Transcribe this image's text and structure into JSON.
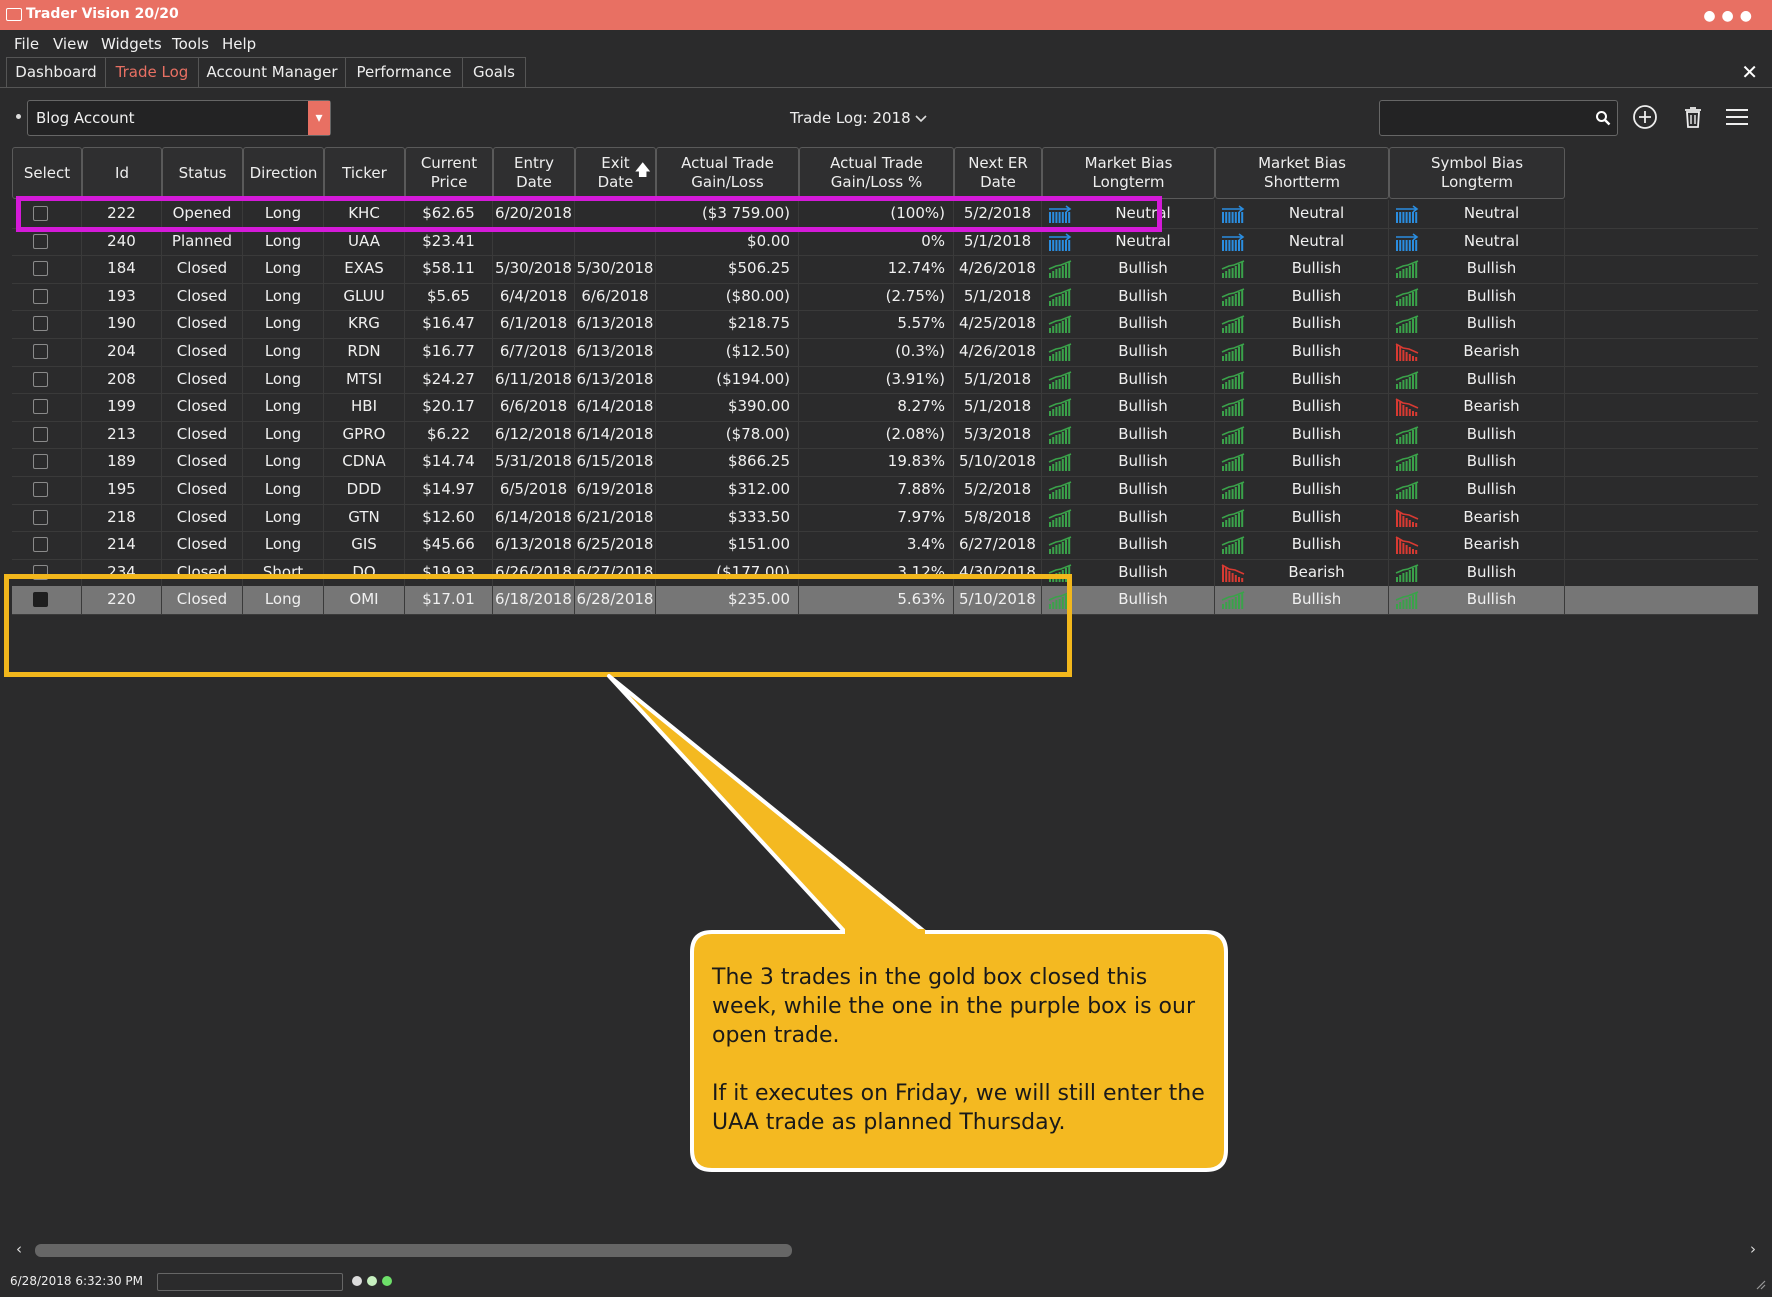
{
  "window": {
    "title": "Trader Vision 20/20"
  },
  "menu": [
    "File",
    "View",
    "Widgets",
    "Tools",
    "Help"
  ],
  "tabs": [
    {
      "label": "Dashboard",
      "active": false
    },
    {
      "label": "Trade Log",
      "active": true
    },
    {
      "label": "Account Manager",
      "active": false
    },
    {
      "label": "Performance",
      "active": false
    },
    {
      "label": "Goals",
      "active": false
    }
  ],
  "toolbar": {
    "account": "Blog Account",
    "trade_log_label": "Trade Log:",
    "year": "2018",
    "search_value": ""
  },
  "table": {
    "columns": [
      "Select",
      "Id",
      "Status",
      "Direction",
      "Ticker",
      "Current Price",
      "Entry Date",
      "Exit Date",
      "Actual Trade Gain/Loss",
      "Actual Trade Gain/Loss %",
      "Next ER Date",
      "Market Bias Longterm",
      "Market Bias Shortterm",
      "Symbol Bias Longterm"
    ],
    "sorted_column": "Exit Date",
    "rows": [
      {
        "checked": false,
        "id": "222",
        "status": "Opened",
        "direction": "Long",
        "ticker": "KHC",
        "price": "$62.65",
        "entry": "6/20/2018",
        "exit": "",
        "gain": "($3 759.00)",
        "gain_pct": "(100%)",
        "next_er": "5/2/2018",
        "mb_long": "Neutral",
        "mb_short": "Neutral",
        "sb_long": "Neutral"
      },
      {
        "checked": false,
        "id": "240",
        "status": "Planned",
        "direction": "Long",
        "ticker": "UAA",
        "price": "$23.41",
        "entry": "",
        "exit": "",
        "gain": "$0.00",
        "gain_pct": "0%",
        "next_er": "5/1/2018",
        "mb_long": "Neutral",
        "mb_short": "Neutral",
        "sb_long": "Neutral"
      },
      {
        "checked": false,
        "id": "184",
        "status": "Closed",
        "direction": "Long",
        "ticker": "EXAS",
        "price": "$58.11",
        "entry": "5/30/2018",
        "exit": "5/30/2018",
        "gain": "$506.25",
        "gain_pct": "12.74%",
        "next_er": "4/26/2018",
        "mb_long": "Bullish",
        "mb_short": "Bullish",
        "sb_long": "Bullish"
      },
      {
        "checked": false,
        "id": "193",
        "status": "Closed",
        "direction": "Long",
        "ticker": "GLUU",
        "price": "$5.65",
        "entry": "6/4/2018",
        "exit": "6/6/2018",
        "gain": "($80.00)",
        "gain_pct": "(2.75%)",
        "next_er": "5/1/2018",
        "mb_long": "Bullish",
        "mb_short": "Bullish",
        "sb_long": "Bullish"
      },
      {
        "checked": false,
        "id": "190",
        "status": "Closed",
        "direction": "Long",
        "ticker": "KRG",
        "price": "$16.47",
        "entry": "6/1/2018",
        "exit": "6/13/2018",
        "gain": "$218.75",
        "gain_pct": "5.57%",
        "next_er": "4/25/2018",
        "mb_long": "Bullish",
        "mb_short": "Bullish",
        "sb_long": "Bullish"
      },
      {
        "checked": false,
        "id": "204",
        "status": "Closed",
        "direction": "Long",
        "ticker": "RDN",
        "price": "$16.77",
        "entry": "6/7/2018",
        "exit": "6/13/2018",
        "gain": "($12.50)",
        "gain_pct": "(0.3%)",
        "next_er": "4/26/2018",
        "mb_long": "Bullish",
        "mb_short": "Bullish",
        "sb_long": "Bearish"
      },
      {
        "checked": false,
        "id": "208",
        "status": "Closed",
        "direction": "Long",
        "ticker": "MTSI",
        "price": "$24.27",
        "entry": "6/11/2018",
        "exit": "6/13/2018",
        "gain": "($194.00)",
        "gain_pct": "(3.91%)",
        "next_er": "5/1/2018",
        "mb_long": "Bullish",
        "mb_short": "Bullish",
        "sb_long": "Bullish"
      },
      {
        "checked": false,
        "id": "199",
        "status": "Closed",
        "direction": "Long",
        "ticker": "HBI",
        "price": "$20.17",
        "entry": "6/6/2018",
        "exit": "6/14/2018",
        "gain": "$390.00",
        "gain_pct": "8.27%",
        "next_er": "5/1/2018",
        "mb_long": "Bullish",
        "mb_short": "Bullish",
        "sb_long": "Bearish"
      },
      {
        "checked": false,
        "id": "213",
        "status": "Closed",
        "direction": "Long",
        "ticker": "GPRO",
        "price": "$6.22",
        "entry": "6/12/2018",
        "exit": "6/14/2018",
        "gain": "($78.00)",
        "gain_pct": "(2.08%)",
        "next_er": "5/3/2018",
        "mb_long": "Bullish",
        "mb_short": "Bullish",
        "sb_long": "Bullish"
      },
      {
        "checked": false,
        "id": "189",
        "status": "Closed",
        "direction": "Long",
        "ticker": "CDNA",
        "price": "$14.74",
        "entry": "5/31/2018",
        "exit": "6/15/2018",
        "gain": "$866.25",
        "gain_pct": "19.83%",
        "next_er": "5/10/2018",
        "mb_long": "Bullish",
        "mb_short": "Bullish",
        "sb_long": "Bullish"
      },
      {
        "checked": false,
        "id": "195",
        "status": "Closed",
        "direction": "Long",
        "ticker": "DDD",
        "price": "$14.97",
        "entry": "6/5/2018",
        "exit": "6/19/2018",
        "gain": "$312.00",
        "gain_pct": "7.88%",
        "next_er": "5/2/2018",
        "mb_long": "Bullish",
        "mb_short": "Bullish",
        "sb_long": "Bullish"
      },
      {
        "checked": false,
        "id": "218",
        "status": "Closed",
        "direction": "Long",
        "ticker": "GTN",
        "price": "$12.60",
        "entry": "6/14/2018",
        "exit": "6/21/2018",
        "gain": "$333.50",
        "gain_pct": "7.97%",
        "next_er": "5/8/2018",
        "mb_long": "Bullish",
        "mb_short": "Bullish",
        "sb_long": "Bearish"
      },
      {
        "checked": false,
        "id": "214",
        "status": "Closed",
        "direction": "Long",
        "ticker": "GIS",
        "price": "$45.66",
        "entry": "6/13/2018",
        "exit": "6/25/2018",
        "gain": "$151.00",
        "gain_pct": "3.4%",
        "next_er": "6/27/2018",
        "mb_long": "Bullish",
        "mb_short": "Bullish",
        "sb_long": "Bearish"
      },
      {
        "checked": false,
        "id": "234",
        "status": "Closed",
        "direction": "Short",
        "ticker": "DO",
        "price": "$19.93",
        "entry": "6/26/2018",
        "exit": "6/27/2018",
        "gain": "($177.00)",
        "gain_pct": "3.12%",
        "next_er": "4/30/2018",
        "mb_long": "Bullish",
        "mb_short": "Bearish",
        "sb_long": "Bullish"
      },
      {
        "checked": true,
        "id": "220",
        "status": "Closed",
        "direction": "Long",
        "ticker": "OMI",
        "price": "$17.01",
        "entry": "6/18/2018",
        "exit": "6/28/2018",
        "gain": "$235.00",
        "gain_pct": "5.63%",
        "next_er": "5/10/2018",
        "mb_long": "Bullish",
        "mb_short": "Bullish",
        "sb_long": "Bullish"
      }
    ]
  },
  "callout": {
    "paragraphs": [
      "The 3 trades in the gold box closed this week, while the one in the purple box is our open trade.",
      "If it executes on Friday, we will still enter the UAA trade as planned Thursday."
    ]
  },
  "status": {
    "timestamp": "6/28/2018 6:32:30 PM"
  },
  "colors": {
    "accent": "#e87063",
    "purple_box": "#d41ad8",
    "gold_box": "#f2b71c",
    "bullish": "#3aa24a",
    "bearish": "#d83a32",
    "neutral": "#2a8de0"
  }
}
